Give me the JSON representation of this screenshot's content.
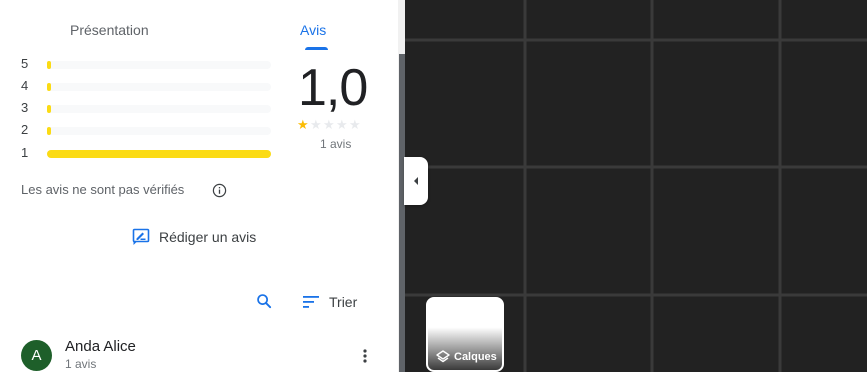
{
  "tabs": [
    {
      "label": "Présentation",
      "active": false
    },
    {
      "label": "Avis",
      "active": true
    }
  ],
  "histogram": [
    {
      "stars": "5",
      "fraction": 0.02
    },
    {
      "stars": "4",
      "fraction": 0.02
    },
    {
      "stars": "3",
      "fraction": 0.02
    },
    {
      "stars": "2",
      "fraction": 0.02
    },
    {
      "stars": "1",
      "fraction": 1.0
    }
  ],
  "summary": {
    "rating": "1,0",
    "stars_filled": 1,
    "stars_total": 5,
    "count": "1 avis"
  },
  "notice": {
    "text": "Les avis ne sont pas vérifiés",
    "icon": "info-icon"
  },
  "actions": {
    "write_review": "Rédiger un avis",
    "write_review_icon": "rate-review-icon",
    "search_icon": "search-icon",
    "sort": "Trier",
    "sort_icon": "sort-icon"
  },
  "reviews": [
    {
      "initial": "A",
      "name": "Anda Alice",
      "count": "1 avis",
      "avatar_color": "#1e5f2a"
    }
  ],
  "map": {
    "layers_label": "Calques",
    "layers_icon": "layers-icon",
    "collapse_icon": "chevron-left-icon"
  },
  "colors": {
    "accent": "#1a73e8",
    "star": "#fbbc04",
    "bar": "#fbdb14",
    "map_bg": "#222222"
  }
}
